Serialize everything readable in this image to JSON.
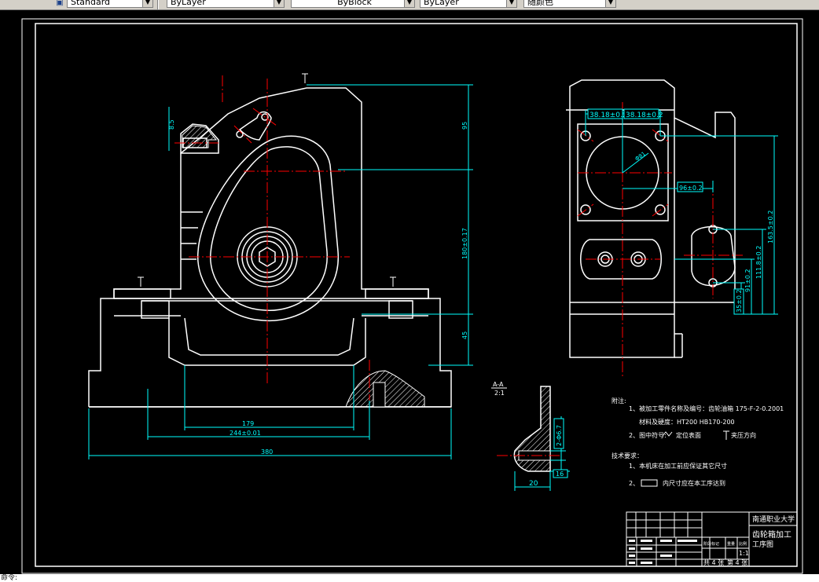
{
  "toolbar": {
    "text_style": "Standard",
    "layer": "ByLayer",
    "linetype": "ByBlock",
    "lineweight": "ByLayer",
    "plotstyle": "随颜色"
  },
  "command_line": "命令:",
  "colors": {
    "white": "#ffffff",
    "cyan": "#00ffff",
    "red": "#ff0000",
    "yellow": "#ffff00",
    "background": "#000000"
  },
  "dims": {
    "d95": "95",
    "d180": "180±0.17",
    "d45": "45",
    "d179": "179",
    "d244": "244±0.01",
    "d380": "380",
    "d885": "8.5",
    "d38a": "38.18±0.2",
    "d38b": "38.18±0.2",
    "dr": "Φ81",
    "d96": "96±0.2",
    "d1635": "163.5±0.2",
    "d1118": "111.8±0.2",
    "d91": "91±0.2",
    "d35": "35±0.2",
    "d2phi": "2-Φ6.7",
    "d16": "16",
    "d20": "20"
  },
  "section": {
    "label": "A-A",
    "scale": "2:1"
  },
  "notes": {
    "heading": "附注:",
    "line1": "1、被加工零件名称及编号：齿轮油箱 175-F-2-0.2001",
    "line1b": "材料及硬度：HT200    HB170-200",
    "line2a": "2、图中符号:",
    "line2b": "定位表面",
    "line2c": "夹压方向",
    "tech_heading": "技术要求：",
    "tech1": "1、本机床在加工前应保证其它尺寸",
    "tech2a": "2、",
    "tech2b": "内尺寸应在本工序达到"
  },
  "title_block": {
    "school": "南通职业大学",
    "title": "齿轮箱加工",
    "subtitle": "工序图",
    "scale_label": "比例",
    "scale_value": "1:1",
    "sheets": "共 4 张",
    "sheet_no": "第 4 张",
    "weight_label": "重量",
    "stage_label": "阶段标记"
  }
}
